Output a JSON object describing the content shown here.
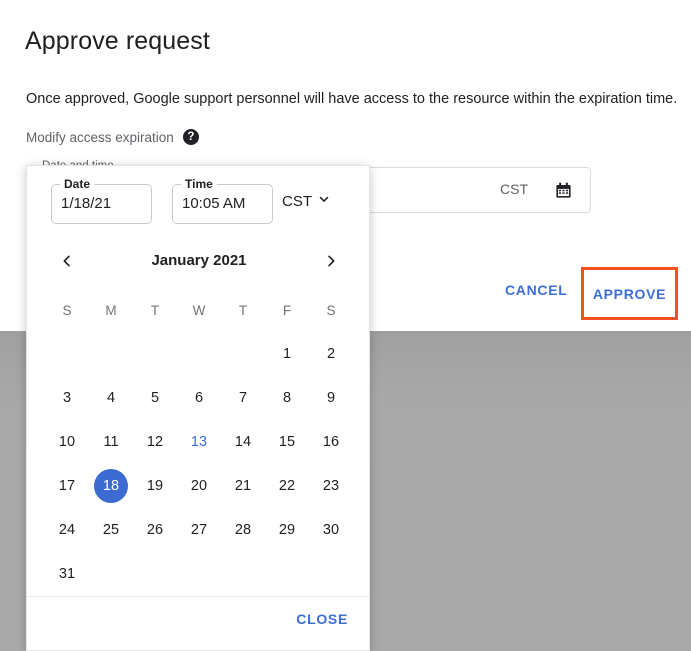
{
  "dialog": {
    "title": "Approve request",
    "body_text": "Once approved, Google support personnel will have access to the resource within the expiration time.",
    "modify_label": "Modify access expiration",
    "help_icon_glyph": "?",
    "cancel_label": "CANCEL",
    "approve_label": "APPROVE"
  },
  "datetime_field": {
    "legend": "Date and time",
    "timezone": "CST",
    "calendar_icon": "calendar-icon"
  },
  "picker": {
    "date": {
      "legend": "Date",
      "value": "1/18/21"
    },
    "time": {
      "legend": "Time",
      "value": "10:05 AM"
    },
    "timezone": {
      "label": "CST",
      "chevron": "chevron-down-icon"
    },
    "month_label": "January 2021",
    "prev_icon": "chevron-left-icon",
    "next_icon": "chevron-right-icon",
    "day_headers": [
      "S",
      "M",
      "T",
      "W",
      "T",
      "F",
      "S"
    ],
    "weeks": [
      [
        "",
        "",
        "",
        "",
        "",
        "1",
        "2"
      ],
      [
        "3",
        "4",
        "5",
        "6",
        "7",
        "8",
        "9"
      ],
      [
        "10",
        "11",
        "12",
        "13",
        "14",
        "15",
        "16"
      ],
      [
        "17",
        "18",
        "19",
        "20",
        "21",
        "22",
        "23"
      ],
      [
        "24",
        "25",
        "26",
        "27",
        "28",
        "29",
        "30"
      ],
      [
        "31",
        "",
        "",
        "",
        "",
        "",
        ""
      ]
    ],
    "today": "13",
    "selected": "18",
    "close_label": "CLOSE"
  },
  "colors": {
    "accent_blue": "#3c6fd6",
    "selected_blue": "#3b6ad1",
    "highlight_red": "#f4511e",
    "scrim_gray": "#a9a9a9",
    "text_primary": "#202124",
    "text_secondary": "#5f6368"
  }
}
